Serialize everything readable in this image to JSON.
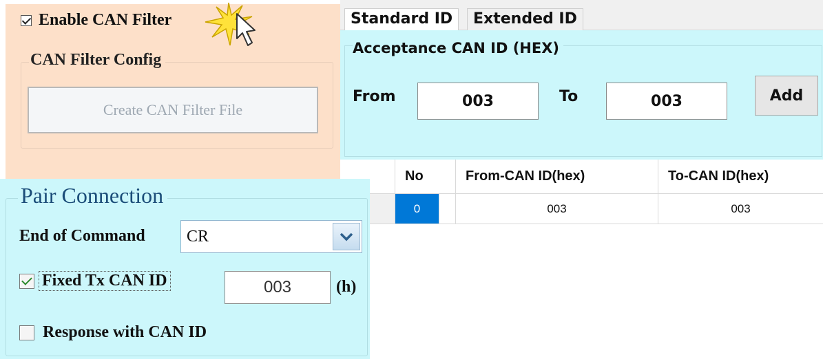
{
  "can_filter": {
    "enable_label": "Enable CAN Filter",
    "enable_checked": true,
    "config_title": "CAN Filter Config",
    "create_button_label": "Create CAN Filter File"
  },
  "tabs": [
    {
      "label": "Standard ID",
      "active": true
    },
    {
      "label": "Extended ID",
      "active": false
    }
  ],
  "acceptance": {
    "title": "Acceptance CAN ID (HEX)",
    "from_label": "From",
    "from_value": "003",
    "to_label": "To",
    "to_value": "003",
    "add_label": "Add"
  },
  "grid": {
    "headers": [
      "",
      "No",
      "From-CAN ID(hex)",
      "To-CAN ID(hex)"
    ],
    "rows": [
      {
        "no": "0",
        "from": "003",
        "to": "003"
      }
    ],
    "selected_color": "#0078d7"
  },
  "pair": {
    "title": "Pair Connection",
    "eoc_label": "End of Command",
    "eoc_value": "CR",
    "fixed_tx_label": "Fixed Tx CAN ID",
    "fixed_tx_checked": true,
    "fixed_tx_value": "003",
    "hex_suffix": "(h)",
    "response_label": "Response with CAN ID",
    "response_checked": false
  },
  "icons": {
    "cursor": "click-burst-cursor-icon",
    "dropdown": "chevron-down-icon"
  }
}
